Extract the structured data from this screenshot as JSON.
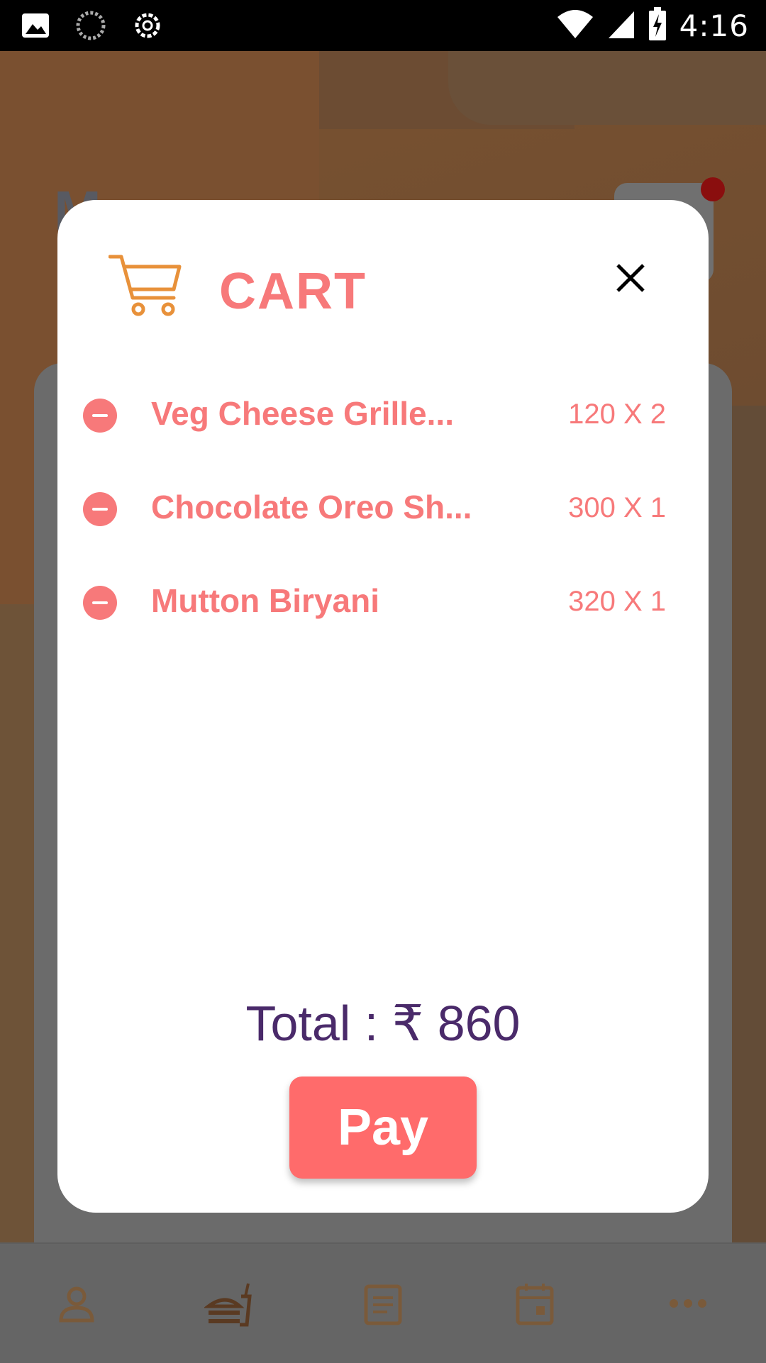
{
  "status_bar": {
    "time": "4:16",
    "icons": [
      "image-icon",
      "loading-icon",
      "settings-icon",
      "wifi-icon",
      "signal-icon",
      "battery-icon"
    ]
  },
  "background": {
    "title": "Menu",
    "nav_items": [
      "profile-icon",
      "food-icon",
      "orders-icon",
      "calendar-icon",
      "more-icon"
    ]
  },
  "cart": {
    "title": "CART",
    "items": [
      {
        "name": "Veg Cheese Grille...",
        "qty": "120 X 2"
      },
      {
        "name": "Chocolate Oreo Sh...",
        "qty": "300 X 1"
      },
      {
        "name": "Mutton Biryani",
        "qty": "320 X 1"
      }
    ],
    "total": "Total : ₹ 860",
    "pay_label": "Pay"
  },
  "colors": {
    "accent": "#f7797a",
    "pay_button": "#ff6b6b",
    "total_text": "#4a2a6a",
    "cart_icon": "#e8913a"
  }
}
